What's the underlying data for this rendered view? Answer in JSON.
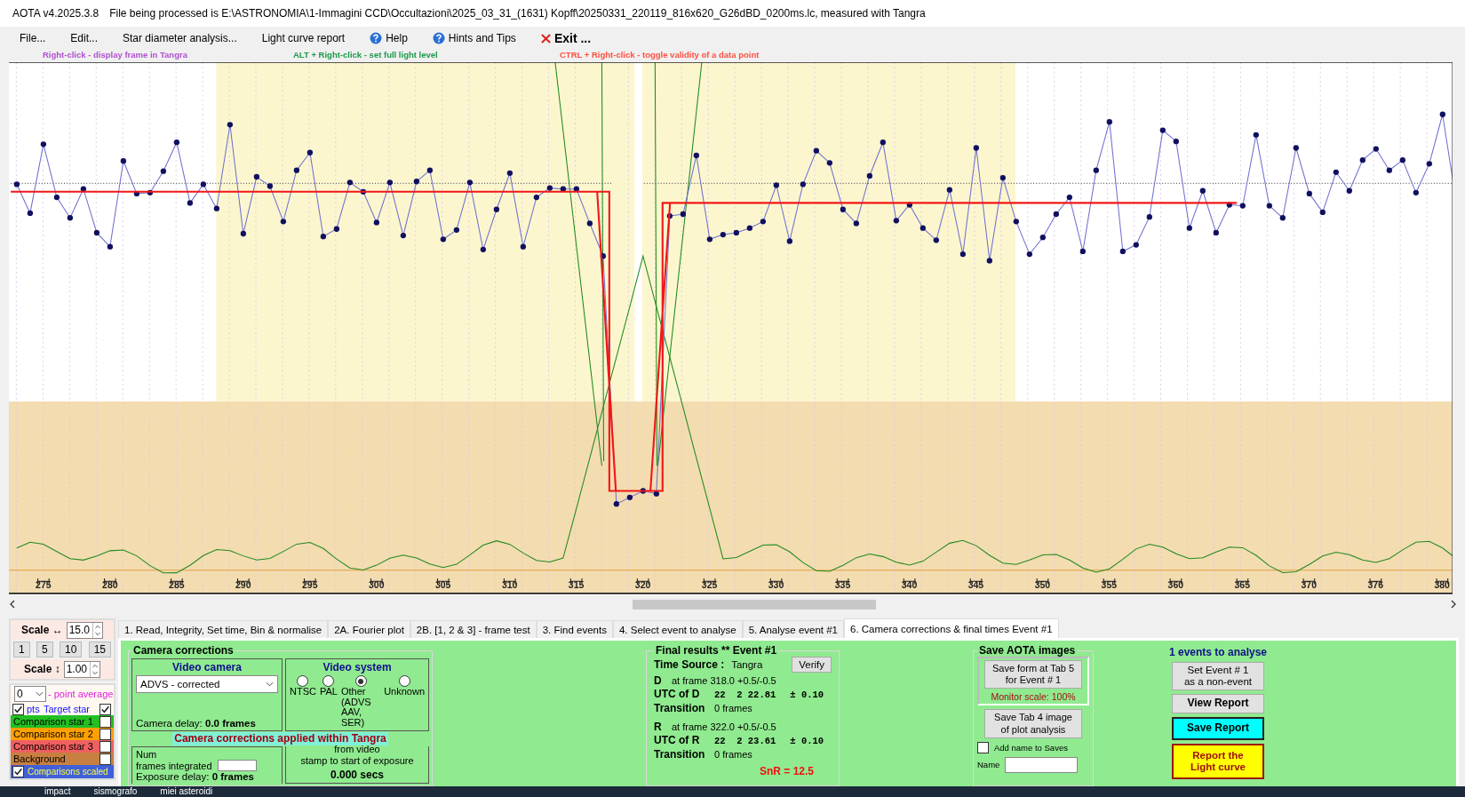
{
  "window": {
    "app": "AOTA v4.2025.3.8",
    "title": "File being processed is E:\\ASTRONOMIA\\1-Immagini CCD\\Occultazioni\\2025_03_31_(1631) Kopff\\20250331_220119_816x620_G26dBD_0200ms.lc, measured with Tangra"
  },
  "menu": [
    {
      "label": "File...",
      "kind": "plain"
    },
    {
      "label": "Edit...",
      "kind": "plain"
    },
    {
      "label": "Star diameter analysis...",
      "kind": "plain"
    },
    {
      "label": "Light curve report",
      "kind": "plain"
    },
    {
      "label": "Help",
      "kind": "help"
    },
    {
      "label": "Hints and Tips",
      "kind": "help"
    },
    {
      "label": "Exit ...",
      "kind": "exit"
    }
  ],
  "hints": [
    {
      "text": "Right-click  -  display frame in Tangra",
      "color": "#b050d0"
    },
    {
      "text": "ALT + Right-click  -  set full light level",
      "color": "#1a9a4a"
    },
    {
      "text": "CTRL + Right-click  -  toggle validity of a data point",
      "color": "#ff5040"
    }
  ],
  "plot": {
    "x_tick_labels": [
      "275",
      "280",
      "285",
      "290",
      "295",
      "300",
      "305",
      "310",
      "315",
      "320",
      "325",
      "330",
      "335",
      "340",
      "345",
      "350",
      "355",
      "360",
      "365",
      "370",
      "376",
      "380"
    ]
  },
  "scale": {
    "horizontal_label": "Scale ↔",
    "horizontal_value": "15.0",
    "presets": [
      "1",
      "5",
      "10",
      "15"
    ],
    "vertical_label": "Scale ↕",
    "vertical_value": "1.00"
  },
  "point_average": {
    "value": "0",
    "label": "- point average"
  },
  "show_points": {
    "label": "pts",
    "checked": true
  },
  "stars": [
    {
      "label": "Target star",
      "checked": true,
      "kind": "text",
      "color": "#1010ff"
    },
    {
      "label": "Comparison star 1",
      "checked": false,
      "kind": "fill",
      "color": "#22c022"
    },
    {
      "label": "Comparison star 2",
      "checked": false,
      "kind": "fill",
      "color": "#ffa000"
    },
    {
      "label": "Comparison star 3",
      "checked": false,
      "kind": "fill",
      "color": "#f06060"
    },
    {
      "label": "Background",
      "checked": false,
      "kind": "fill",
      "color": "#c88040"
    }
  ],
  "comparisons_scaled": {
    "label": "Comparisons scaled",
    "checked": true
  },
  "tabs": [
    {
      "label": "1.  Read, Integrity, Set time, Bin & normalise",
      "selected": false
    },
    {
      "label": "2A. Fourier plot",
      "selected": false
    },
    {
      "label": "2B. [1, 2 & 3] - frame test",
      "selected": false
    },
    {
      "label": "3. Find events",
      "selected": false
    },
    {
      "label": "4. Select event to analyse",
      "selected": false
    },
    {
      "label": "5. Analyse event #1",
      "selected": false
    },
    {
      "label": "6. Camera corrections & final times Event #1",
      "selected": true
    }
  ],
  "camera_corrections": {
    "title": "Camera corrections",
    "video_camera": {
      "title": "Video camera",
      "selection": "ADVS - corrected",
      "delay_label": "Camera delay:",
      "delay_value": "0.0 frames"
    },
    "video_system": {
      "title": "Video system",
      "options": [
        {
          "label": "NTSC",
          "selected": false
        },
        {
          "label": "PAL",
          "selected": false
        },
        {
          "label": "Other\n(ADVS\nAAV, SER)",
          "selected": true
        },
        {
          "label": "Unknown",
          "selected": false
        }
      ]
    },
    "frames_label_start": "Num",
    "frames_label_end": "frames integrated",
    "notice": "Camera corrections applied within Tangra",
    "offset_label": "from video\nstamp to start of exposure",
    "offset_value": "0.000 secs",
    "exposure_delay_label": "Exposure delay:",
    "exposure_delay_value": "0 frames"
  },
  "final_results": {
    "title": "Final results  **  Event #1",
    "time_source_label": "Time Source :",
    "time_source": "Tangra",
    "verify_button": "Verify",
    "events": [
      {
        "letter": "D",
        "at_frame": "at frame 318.0  +0.5/-0.5",
        "utc_label": "UTC of D",
        "utc": "22  2 22.81",
        "pm": "± 0.10",
        "transition_label": "Transition",
        "transition": "0 frames"
      },
      {
        "letter": "R",
        "at_frame": "at frame 322.0  +0.5/-0.5",
        "utc_label": "UTC of R",
        "utc": "22  2 23.61",
        "pm": "± 0.10",
        "transition_label": "Transition",
        "transition": "0 frames"
      }
    ],
    "snr": "SnR = 12.5"
  },
  "save_images": {
    "title": "Save AOTA images",
    "save_form_button": "Save form at Tab 5\nfor Event # 1",
    "monitor_scale": "Monitor scale: 100%",
    "save_tab4_button": "Save Tab 4 image\nof plot analysis",
    "add_name": {
      "label": "Add name to Saves",
      "checked": false
    },
    "name_label": "Name"
  },
  "actions": {
    "events_count": "1  events to analyse",
    "buttons": [
      {
        "label": "Set Event # 1\nas a non-event",
        "kind": "plain"
      },
      {
        "label": "View Report",
        "kind": "bold"
      },
      {
        "label": "Save Report",
        "kind": "cyan"
      },
      {
        "label": "Report the\nLight curve",
        "kind": "yellow"
      }
    ]
  },
  "desktop": [
    "impact",
    "sismografo",
    "miei asteroidi"
  ]
}
